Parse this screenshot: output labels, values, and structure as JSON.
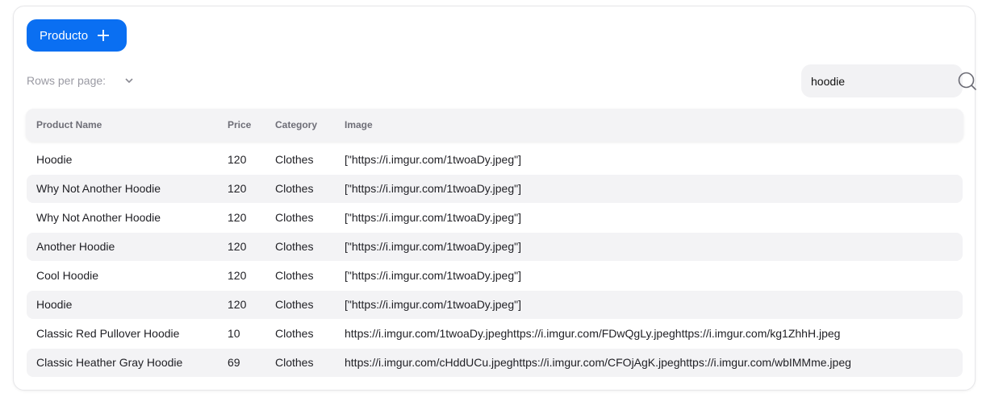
{
  "toolbar": {
    "add_label": "Producto"
  },
  "pagination": {
    "rows_per_page_label": "Rows per page:"
  },
  "search": {
    "value": "hoodie"
  },
  "table": {
    "columns": [
      "Product Name",
      "Price",
      "Category",
      "Image"
    ],
    "rows": [
      [
        "Hoodie",
        "120",
        "Clothes",
        "[\"https://i.imgur.com/1twoaDy.jpeg\"]"
      ],
      [
        "Why Not Another Hoodie",
        "120",
        "Clothes",
        "[\"https://i.imgur.com/1twoaDy.jpeg\"]"
      ],
      [
        "Why Not Another Hoodie",
        "120",
        "Clothes",
        "[\"https://i.imgur.com/1twoaDy.jpeg\"]"
      ],
      [
        "Another Hoodie",
        "120",
        "Clothes",
        "[\"https://i.imgur.com/1twoaDy.jpeg\"]"
      ],
      [
        "Cool Hoodie",
        "120",
        "Clothes",
        "[\"https://i.imgur.com/1twoaDy.jpeg\"]"
      ],
      [
        "Hoodie",
        "120",
        "Clothes",
        "[\"https://i.imgur.com/1twoaDy.jpeg\"]"
      ],
      [
        "Classic Red Pullover Hoodie",
        "10",
        "Clothes",
        "https://i.imgur.com/1twoaDy.jpeghttps://i.imgur.com/FDwQgLy.jpeghttps://i.imgur.com/kg1ZhhH.jpeg"
      ],
      [
        "Classic Heather Gray Hoodie",
        "69",
        "Clothes",
        "https://i.imgur.com/cHddUCu.jpeghttps://i.imgur.com/CFOjAgK.jpeghttps://i.imgur.com/wbIMMme.jpeg"
      ]
    ]
  },
  "icons": {
    "add": "plus-icon",
    "rows_select": "chevron-down-icon",
    "search": "search-icon"
  },
  "colors": {
    "primary": "#0a6ff2",
    "stripe": "#f3f3f5",
    "muted_text": "#9a9aa3"
  }
}
